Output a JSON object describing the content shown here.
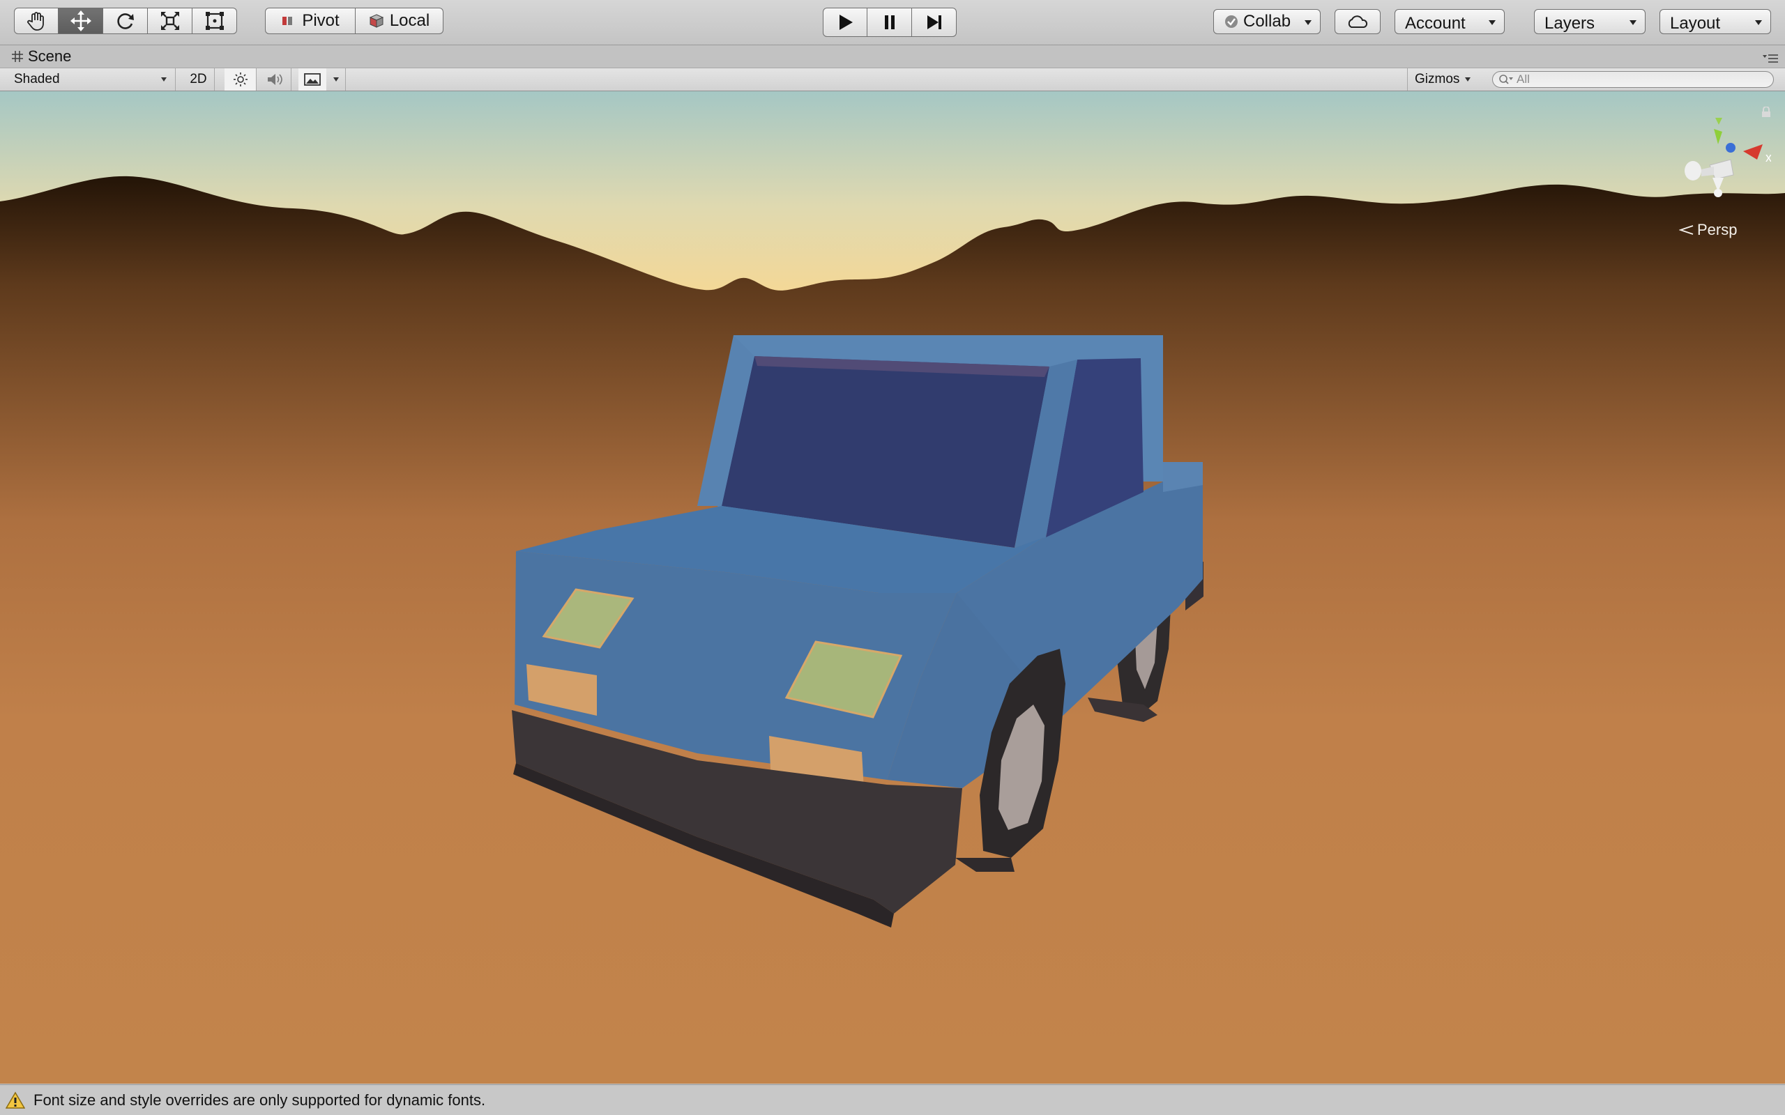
{
  "toolbar": {
    "tools": [
      {
        "name": "hand-tool",
        "icon": "hand-icon"
      },
      {
        "name": "move-tool",
        "icon": "move-arrows-icon",
        "active": true
      },
      {
        "name": "rotate-tool",
        "icon": "rotate-icon"
      },
      {
        "name": "scale-tool",
        "icon": "scale-icon"
      },
      {
        "name": "rect-tool",
        "icon": "rect-transform-icon"
      }
    ],
    "pivot_label": "Pivot",
    "local_label": "Local",
    "play_icon": "play-icon",
    "pause_icon": "pause-icon",
    "step_icon": "step-icon",
    "collab_label": "Collab",
    "cloud_icon": "cloud-icon",
    "account_label": "Account",
    "layers_label": "Layers",
    "layout_label": "Layout"
  },
  "scene_tab": {
    "title": "Scene",
    "icon": "scene-grid-icon"
  },
  "scene_toolbar": {
    "draw_mode": "Shaded",
    "mode_2d": "2D",
    "lighting_icon": "sun-icon",
    "audio_icon": "speaker-icon",
    "effects_icon": "image-icon",
    "gizmos_label": "Gizmos",
    "search_placeholder": "All"
  },
  "viewport": {
    "projection_label": "Persp",
    "gizmo_axis_x": "x",
    "colors": {
      "sky_top": "#a9c9c2",
      "sky_horizon": "#f3dca0",
      "ground": "#c0804a",
      "car_body": "#4a74a6"
    }
  },
  "status": {
    "warning_icon": "warning-icon",
    "message": "Font size and style overrides are only supported for dynamic fonts."
  }
}
